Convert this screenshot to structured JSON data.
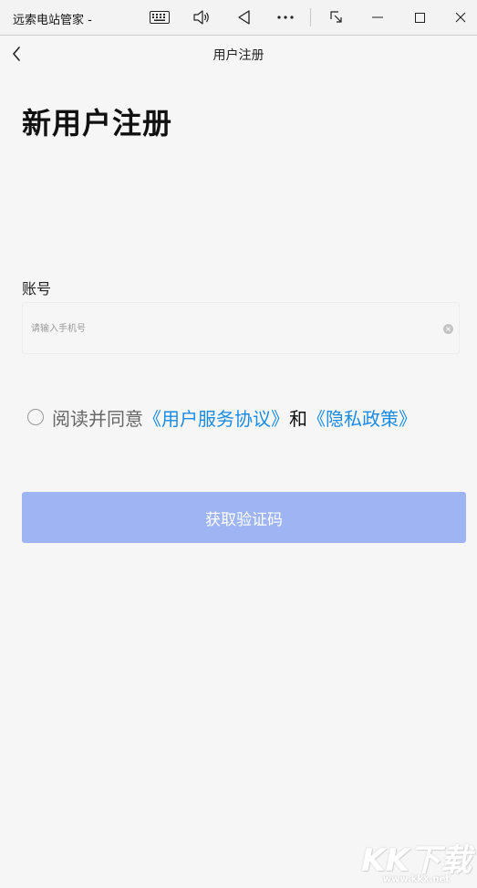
{
  "window": {
    "title": "远索电站管家 -",
    "controls": [
      "keyboard-icon",
      "volume-icon",
      "back-triangle-icon",
      "more-icon",
      "resize-icon",
      "minimize-icon",
      "maximize-icon",
      "close-icon"
    ]
  },
  "navbar": {
    "title": "用户注册"
  },
  "page": {
    "heading": "新用户注册"
  },
  "form": {
    "account_label": "账号",
    "account_value": "",
    "account_placeholder": "请输入手机号"
  },
  "agreement": {
    "checked": false,
    "prefix": "阅读并同意",
    "service_link": "《用户服务协议》",
    "and": "和",
    "privacy_link": "《隐私政策》"
  },
  "submit": {
    "label": "获取验证码"
  },
  "watermark": {
    "text": "KK下载",
    "url": "www.kkx.net"
  },
  "colors": {
    "link": "#1a8be5",
    "button_disabled": "#9fb5f3",
    "background": "#f6f6f7"
  }
}
